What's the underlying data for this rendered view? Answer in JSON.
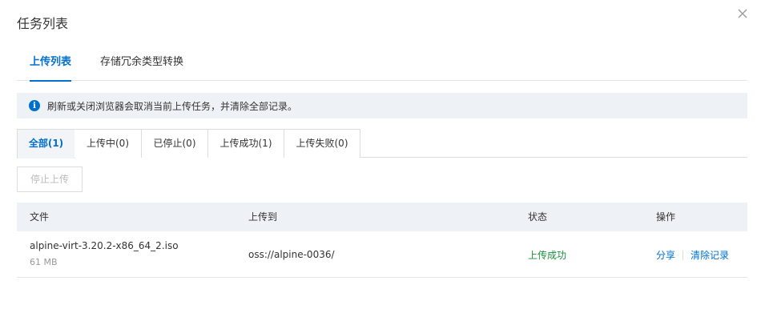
{
  "dialog": {
    "title": "任务列表",
    "close_icon": "close-icon"
  },
  "tabs": [
    {
      "label": "上传列表",
      "active": true
    },
    {
      "label": "存储冗余类型转换",
      "active": false
    }
  ],
  "notice": {
    "icon": "info-icon",
    "glyph": "i",
    "text": "刷新或关闭浏览器会取消当前上传任务，并清除全部记录。"
  },
  "filters": [
    {
      "label": "全部(1)",
      "active": true
    },
    {
      "label": "上传中(0)",
      "active": false
    },
    {
      "label": "已停止(0)",
      "active": false
    },
    {
      "label": "上传成功(1)",
      "active": false
    },
    {
      "label": "上传失败(0)",
      "active": false
    }
  ],
  "toolbar": {
    "stop_label": "停止上传",
    "stop_disabled": true
  },
  "table": {
    "columns": [
      "文件",
      "上传到",
      "状态",
      "操作"
    ],
    "rows": [
      {
        "file": "alpine-virt-3.20.2-x86_64_2.iso",
        "size": "61 MB",
        "destination": "oss://alpine-0036/",
        "status": "上传成功",
        "actions": [
          "分享",
          "清除记录"
        ]
      }
    ]
  },
  "colors": {
    "accent": "#0070cc",
    "success": "#1e8e3e",
    "header_bg": "#eef1f6"
  }
}
